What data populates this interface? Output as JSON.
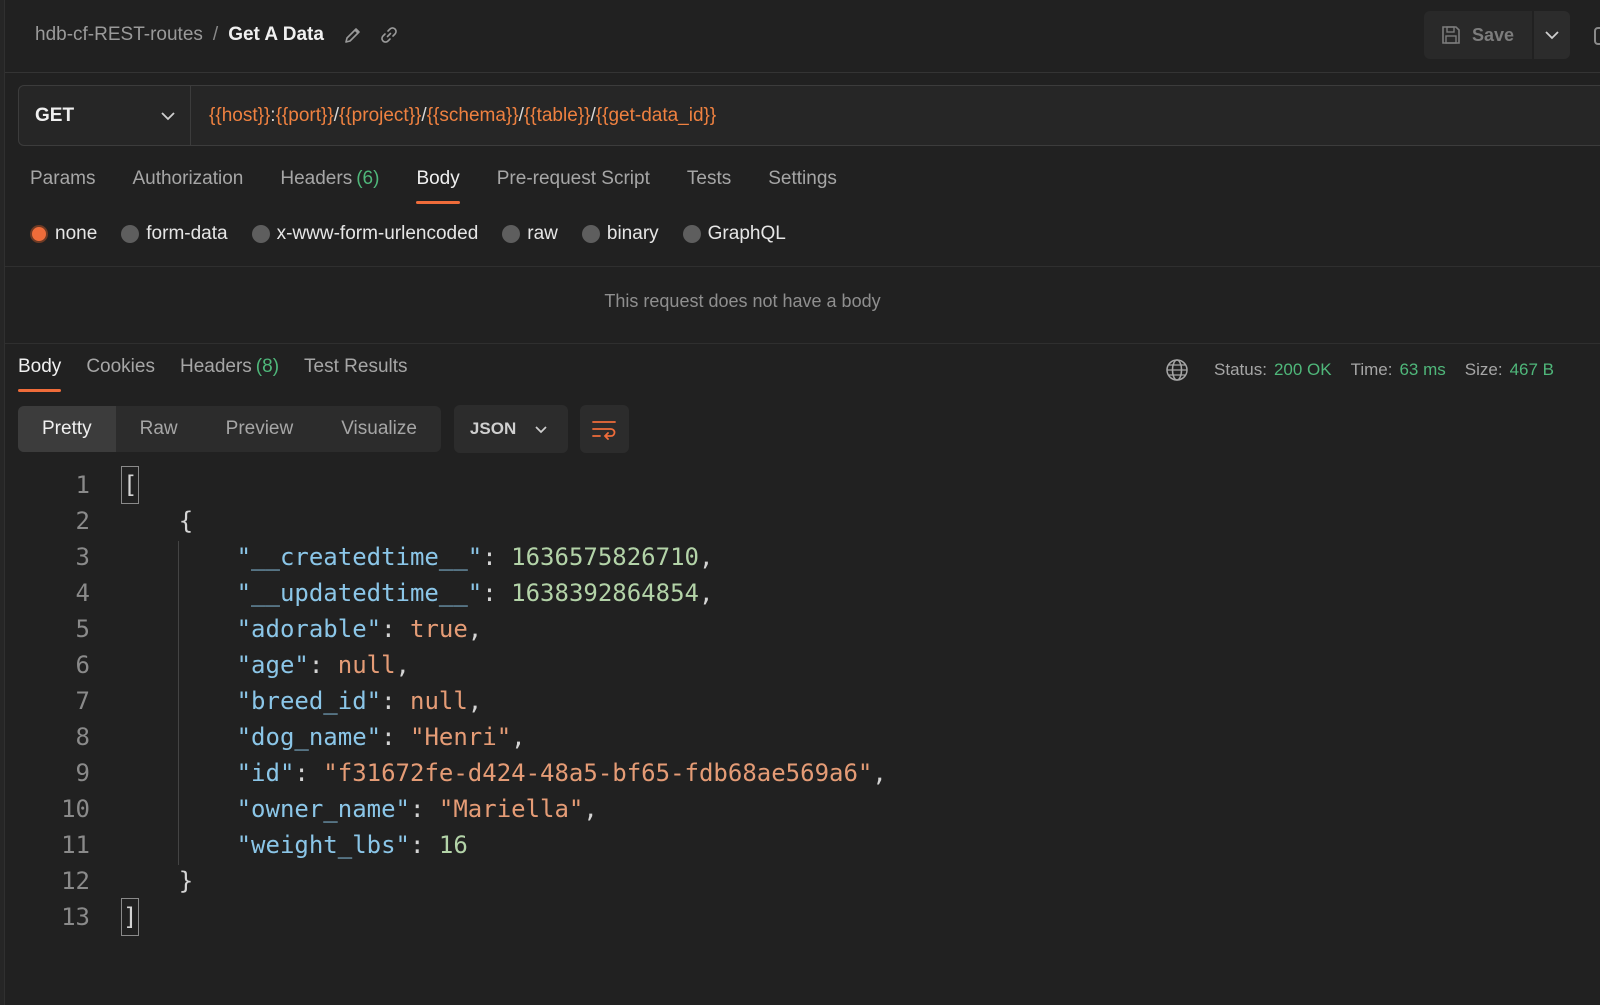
{
  "header": {
    "collection": "hdb-cf-REST-routes",
    "separator": "/",
    "request_name": "Get A Data",
    "save_label": "Save"
  },
  "request": {
    "method": "GET",
    "url_parts": [
      {
        "text": "{{host}}",
        "var": true
      },
      {
        "text": ":",
        "var": false
      },
      {
        "text": "{{port}}",
        "var": true
      },
      {
        "text": "/",
        "var": false
      },
      {
        "text": "{{project}}",
        "var": true
      },
      {
        "text": "/",
        "var": false
      },
      {
        "text": "{{schema}}",
        "var": true
      },
      {
        "text": "/",
        "var": false
      },
      {
        "text": "{{table}}",
        "var": true
      },
      {
        "text": "/",
        "var": false
      },
      {
        "text": "{{get-data_id}}",
        "var": true
      }
    ],
    "tabs": {
      "params": "Params",
      "authorization": "Authorization",
      "headers": "Headers",
      "headers_count": "(6)",
      "body": "Body",
      "prerequest": "Pre-request Script",
      "tests": "Tests",
      "settings": "Settings"
    },
    "body_options": {
      "none": "none",
      "form_data": "form-data",
      "urlencoded": "x-www-form-urlencoded",
      "raw": "raw",
      "binary": "binary",
      "graphql": "GraphQL"
    },
    "no_body_message": "This request does not have a body"
  },
  "response": {
    "tabs": {
      "body": "Body",
      "cookies": "Cookies",
      "headers": "Headers",
      "headers_count": "(8)",
      "test_results": "Test Results"
    },
    "status_label": "Status:",
    "status_value": "200 OK",
    "time_label": "Time:",
    "time_value": "63 ms",
    "size_label": "Size:",
    "size_value": "467 B",
    "views": {
      "pretty": "Pretty",
      "raw": "Raw",
      "preview": "Preview",
      "visualize": "Visualize"
    },
    "format": "JSON",
    "code_lines": [
      {
        "n": "1"
      },
      {
        "n": "2"
      },
      {
        "n": "3",
        "key": "\"__createdtime__\"",
        "value": "1636575826710"
      },
      {
        "n": "4",
        "key": "\"__updatedtime__\"",
        "value": "1638392864854"
      },
      {
        "n": "5",
        "key": "\"adorable\"",
        "value": "true"
      },
      {
        "n": "6",
        "key": "\"age\"",
        "value": "null"
      },
      {
        "n": "7",
        "key": "\"breed_id\"",
        "value": "null"
      },
      {
        "n": "8",
        "key": "\"dog_name\"",
        "value": "\"Henri\""
      },
      {
        "n": "9",
        "key": "\"id\"",
        "value": "\"f31672fe-d424-48a5-bf65-fdb68ae569a6\""
      },
      {
        "n": "10",
        "key": "\"owner_name\"",
        "value": "\"Mariella\""
      },
      {
        "n": "11",
        "key": "\"weight_lbs\"",
        "value": "16"
      },
      {
        "n": "12"
      },
      {
        "n": "13"
      }
    ]
  },
  "colors": {
    "accent": "#ef6c3a",
    "variable": "#ef8140",
    "success": "#4fb77a",
    "json_key": "#8bc6e8",
    "json_number": "#b3d3a8",
    "json_string": "#e59c76"
  }
}
